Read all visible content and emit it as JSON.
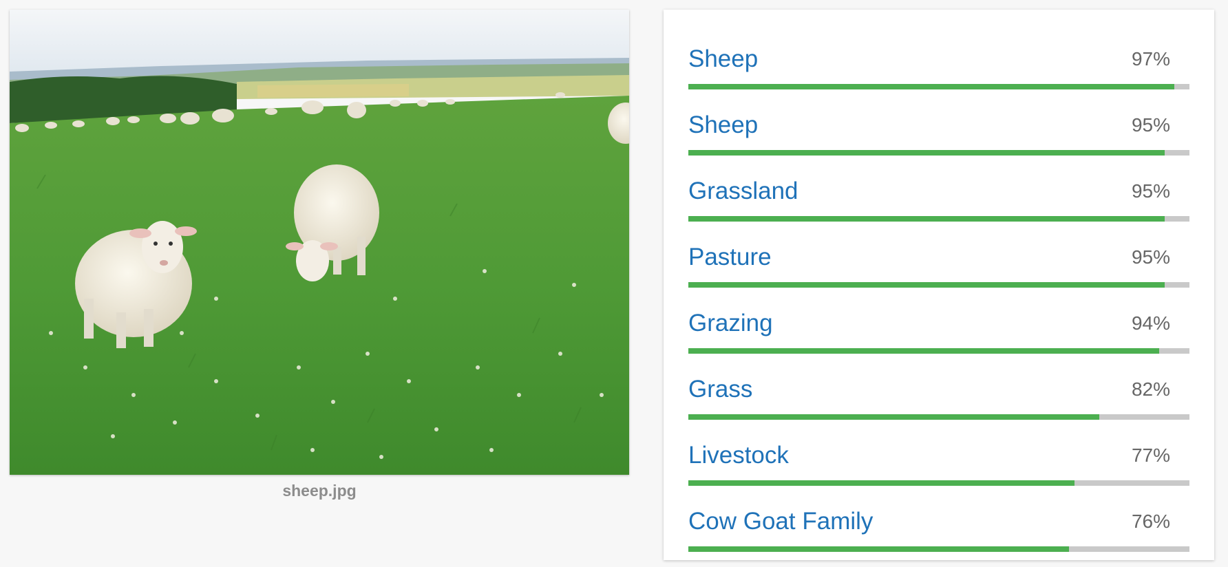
{
  "image": {
    "filename": "sheep.jpg"
  },
  "labels": [
    {
      "name": "Sheep",
      "score_text": "97%",
      "score": 0.97
    },
    {
      "name": "Sheep",
      "score_text": "95%",
      "score": 0.95
    },
    {
      "name": "Grassland",
      "score_text": "95%",
      "score": 0.95
    },
    {
      "name": "Pasture",
      "score_text": "95%",
      "score": 0.95
    },
    {
      "name": "Grazing",
      "score_text": "94%",
      "score": 0.94
    },
    {
      "name": "Grass",
      "score_text": "82%",
      "score": 0.82
    },
    {
      "name": "Livestock",
      "score_text": "77%",
      "score": 0.77
    },
    {
      "name": "Cow Goat Family",
      "score_text": "76%",
      "score": 0.76
    }
  ],
  "colors": {
    "label_text": "#1f72b8",
    "score_text": "#666666",
    "bar_fill": "#4caf50",
    "bar_track": "#c9c9c9"
  }
}
